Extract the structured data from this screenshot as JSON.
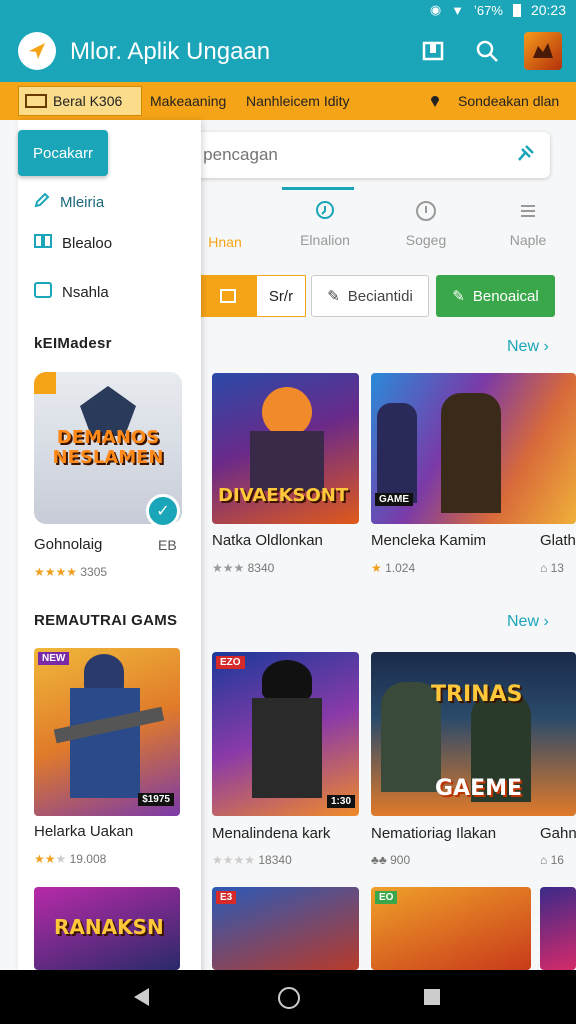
{
  "status_bar": {
    "signal_text": "ʼ67%",
    "time": "20:23"
  },
  "app_bar": {
    "title": "Mlor. Aplik Ungaan"
  },
  "strip": {
    "tab1": "Beral K306",
    "tab2": "Makeaaning",
    "tab3": "Nanhleicem Idity",
    "location": "Sondeakan dlan"
  },
  "drawer": {
    "button": "Pocakarr",
    "items": [
      {
        "label": "Mleiria",
        "icon": "pencil-icon"
      },
      {
        "label": "Blealoo",
        "icon": "book-icon"
      },
      {
        "label": "Nsahla",
        "icon": "square-icon"
      }
    ],
    "section1": "kEIMadesr",
    "section2": "REMAUTRAI GAMS"
  },
  "search": {
    "placeholder": "Ser pencagan"
  },
  "tabs": [
    {
      "label": "Hnan",
      "icon": "home-icon"
    },
    {
      "label": "Elnalion",
      "icon": "location-icon"
    },
    {
      "label": "Sogeg",
      "icon": "info-icon"
    },
    {
      "label": "Naple",
      "icon": "grid-icon"
    }
  ],
  "filters": {
    "sort": "Sr/r",
    "recent": "Beciantidi",
    "recommended": "Benoaical"
  },
  "new_label": "New",
  "cards_row1": [
    {
      "title": "Gohnolaig",
      "rating": "3305",
      "extra": "EB",
      "art": "DEMANOS NESLAMEN"
    },
    {
      "title": "Natka Oldlonkan",
      "rating": "8340",
      "art": "DIVAEKSONT"
    },
    {
      "title": "Mencleka Kamim",
      "rating": "1.024",
      "art": ""
    },
    {
      "title": "Glath",
      "rating": "13",
      "art": ""
    }
  ],
  "cards_row2": [
    {
      "title": "Helarka Uakan",
      "rating": "19.008",
      "art": "$1975"
    },
    {
      "title": "Menalindena kark",
      "rating": "18340",
      "art": ""
    },
    {
      "title": "Nematioriag Ilakan",
      "rating": "900",
      "art": "GAEME"
    },
    {
      "title": "Gahnd",
      "rating": "16",
      "art": ""
    }
  ],
  "cards_row3": [
    {
      "art": "RANAKSN"
    },
    {
      "art": ""
    },
    {
      "art": ""
    },
    {
      "art": ""
    }
  ],
  "colors": {
    "primary": "#1aa5b8",
    "accent": "#f6a417",
    "green": "#3aa84a"
  }
}
